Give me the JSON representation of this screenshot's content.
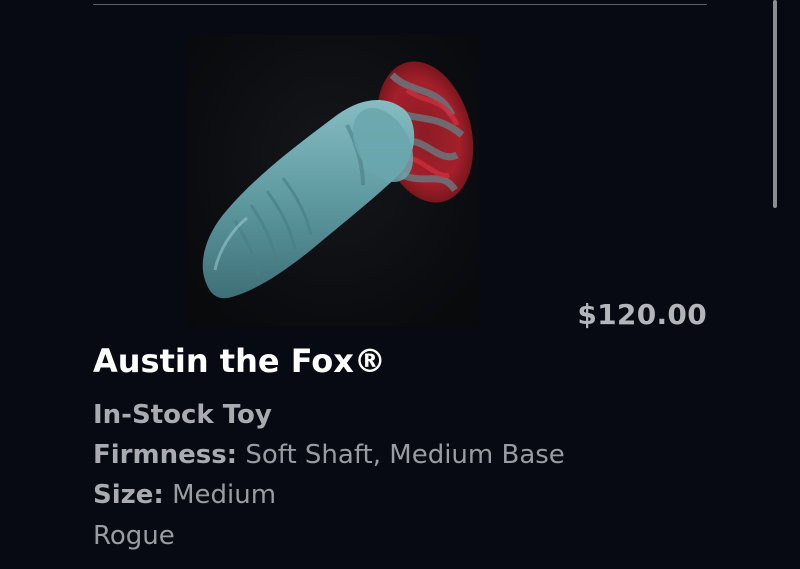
{
  "product": {
    "name": "Austin the Fox®",
    "price": "$120.00",
    "stock_status": "In-Stock Toy",
    "firmness_label": "Firmness:",
    "firmness_value": "Soft Shaft, Medium Base",
    "size_label": "Size:",
    "size_value": "Medium",
    "colorway": "Rogue",
    "image_colors": {
      "shaft": "#5f9aa1",
      "base_red": "#a41f2a",
      "base_gray": "#6d7078"
    }
  }
}
